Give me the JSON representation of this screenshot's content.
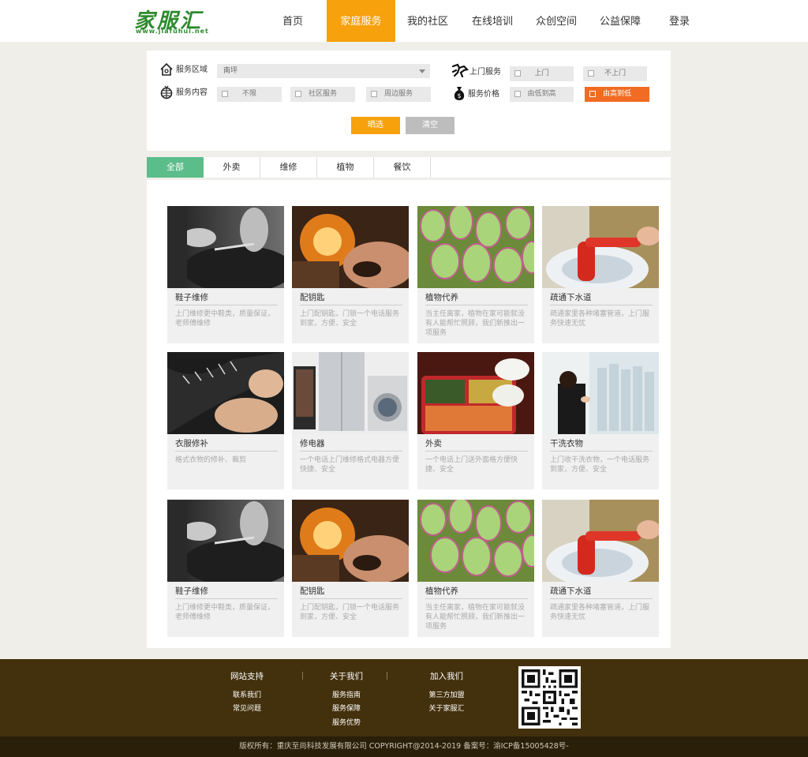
{
  "header": {
    "logo_text": "家服汇",
    "logo_url": "www.jiafuhui.net",
    "nav": [
      {
        "label": "首页"
      },
      {
        "label": "家庭服务"
      },
      {
        "label": "我的社区"
      },
      {
        "label": "在线培训"
      },
      {
        "label": "众创空间"
      },
      {
        "label": "公益保障"
      },
      {
        "label": "登录"
      }
    ],
    "active_color": "#f7a10d"
  },
  "filter": {
    "area_label": "服务区域",
    "area_value": "南坪",
    "content_label": "服务内容",
    "content_options": [
      "不限",
      "社区服务",
      "周边服务"
    ],
    "home_label": "上门服务",
    "home_options": [
      "上门",
      "不上门"
    ],
    "price_label": "服务价格",
    "price_options": [
      "由低到高",
      "由高到低"
    ],
    "filter_button": "晒选",
    "clear_button": "清空",
    "accent_color": "#f26b23"
  },
  "tabs": [
    "全部",
    "外卖",
    "维修",
    "植物",
    "餐饮"
  ],
  "cards": [
    {
      "title": "鞋子维修",
      "desc": "上门维修更中鞋类，质量保证，老师傅维修",
      "img": "shoe"
    },
    {
      "title": "配钥匙",
      "desc": "上门配钥匙，门锁一个电话服务到家，方便、安全",
      "img": "key"
    },
    {
      "title": "植物代养",
      "desc": "当主任离家，植物在家可能就没有人能帮忙照顾，我们新推出一项服务",
      "img": "plant"
    },
    {
      "title": "疏通下水道",
      "desc": "疏通家里各种堵塞管道，上门服务快速无忧",
      "img": "plunger"
    },
    {
      "title": "衣服修补",
      "desc": "格式衣物的修补、裁剪",
      "img": "sew"
    },
    {
      "title": "修电器",
      "desc": "一个电话上门维修格式电器方便快捷、安全",
      "img": "appliance"
    },
    {
      "title": "外卖",
      "desc": "一个电话上门送外面格方便快捷、安全",
      "img": "food"
    },
    {
      "title": "干洗衣物",
      "desc": "上门收干洗衣物，一个电话服务到家，方便、安全",
      "img": "laundry"
    },
    {
      "title": "鞋子维修",
      "desc": "上门维修更中鞋类，质量保证，老师傅维修",
      "img": "shoe"
    },
    {
      "title": "配钥匙",
      "desc": "上门配钥匙，门锁一个电话服务到家，方便、安全",
      "img": "key"
    },
    {
      "title": "植物代养",
      "desc": "当主任离家，植物在家可能就没有人能帮忙照顾，我们新推出一项服务",
      "img": "plant"
    },
    {
      "title": "疏通下水道",
      "desc": "疏通家里各种堵塞管道，上门服务快速无忧",
      "img": "plunger"
    }
  ],
  "footer": {
    "columns": [
      {
        "head": "网站支持",
        "links": [
          "联系我们",
          "常见问题"
        ]
      },
      {
        "head": "关于我们",
        "links": [
          "服务指南",
          "服务保障",
          "服务优势"
        ]
      },
      {
        "head": "加入我们",
        "links": [
          "第三方加盟",
          "关于家服汇"
        ]
      }
    ],
    "copyright": "版权所有：重庆至尚科技发展有限公司 COPYRIGHT@2014-2019 备案号：渝ICP备15005428号-"
  }
}
